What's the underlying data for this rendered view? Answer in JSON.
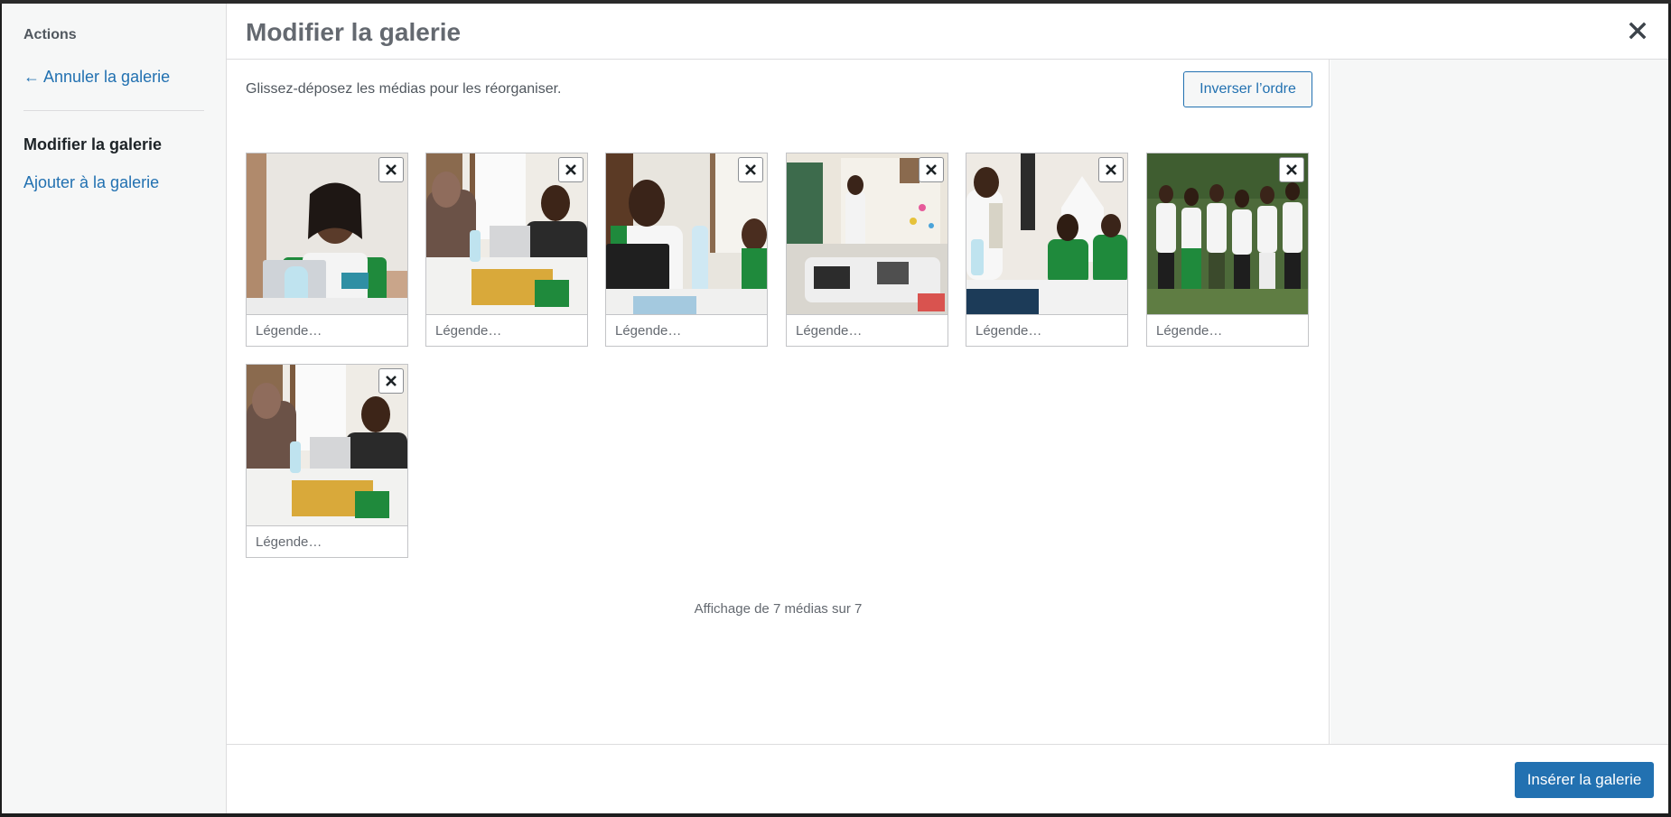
{
  "menu": {
    "heading": "Actions",
    "cancel_label": "← Annuler la galerie",
    "active_label": "Modifier la galerie",
    "add_label": "Ajouter à la galerie"
  },
  "header": {
    "title": "Modifier la galerie",
    "close_icon": "close-icon"
  },
  "toolbar": {
    "instructions": "Glissez-déposez les médias pour les réorganiser.",
    "reverse_label": "Inverser l’ordre"
  },
  "gallery": {
    "items": [
      {
        "caption_placeholder": "Légende…",
        "scene": "woman-presenting"
      },
      {
        "caption_placeholder": "Légende…",
        "scene": "meeting-table"
      },
      {
        "caption_placeholder": "Légende…",
        "scene": "man-at-laptop"
      },
      {
        "caption_placeholder": "Légende…",
        "scene": "workshop-board"
      },
      {
        "caption_placeholder": "Légende…",
        "scene": "group-discussion"
      },
      {
        "caption_placeholder": "Légende…",
        "scene": "group-photo-outdoor"
      },
      {
        "caption_placeholder": "Légende…",
        "scene": "meeting-table"
      }
    ],
    "count_text": "Affichage de 7 médias sur 7"
  },
  "footer": {
    "insert_label": "Insérer la galerie"
  },
  "colors": {
    "accent": "#2271b1",
    "green_shirt": "#1f8a3c"
  }
}
